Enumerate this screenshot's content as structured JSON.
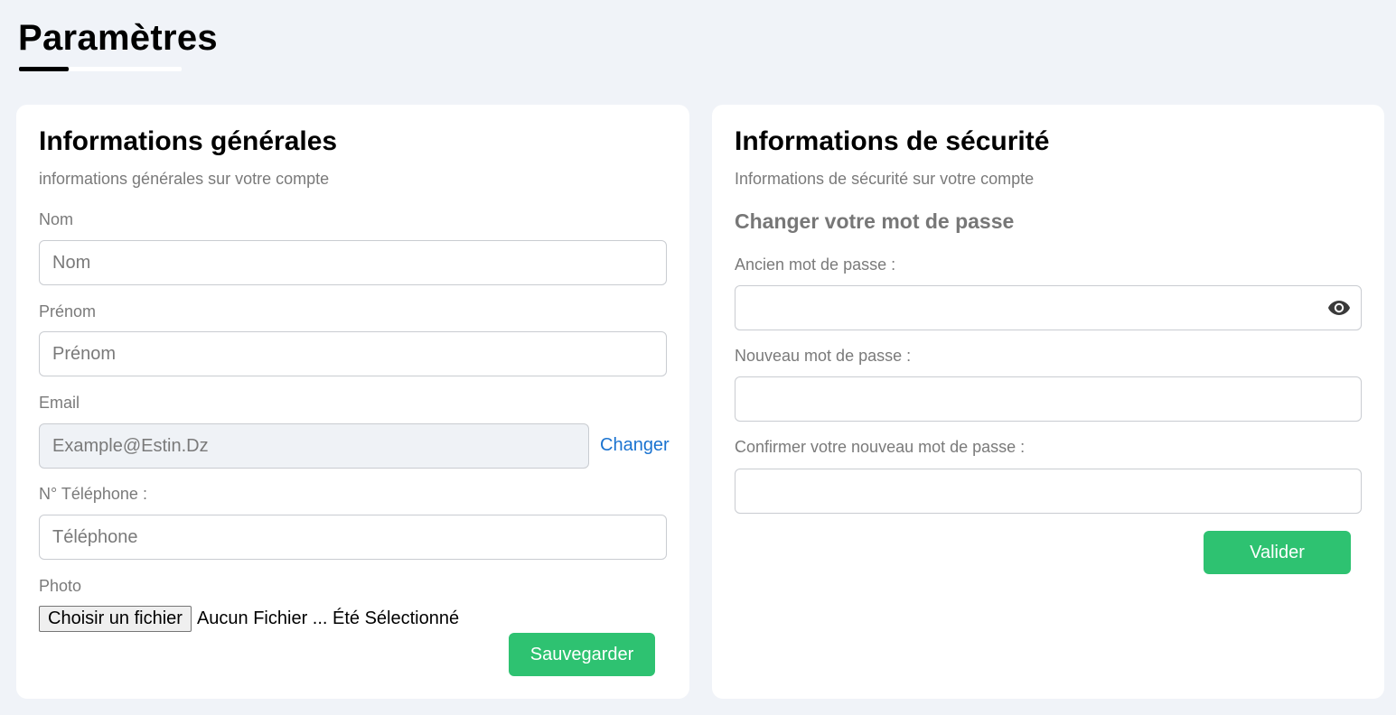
{
  "page": {
    "title": "Paramètres"
  },
  "general": {
    "title": "Informations générales",
    "subtitle": "informations générales sur votre compte",
    "nom_label": "Nom",
    "nom_placeholder": "Nom",
    "prenom_label": "Prénom",
    "prenom_placeholder": "Prénom",
    "email_label": "Email",
    "email_placeholder": "Example@Estin.Dz",
    "change_link": "Changer",
    "phone_label": "N° Téléphone :",
    "phone_placeholder": "Téléphone",
    "photo_label": "Photo",
    "file_button": "Choisir un fichier",
    "file_status": "Aucun Fichier ... Été Sélectionné",
    "save_button": "Sauvegarder"
  },
  "security": {
    "title": "Informations de sécurité",
    "subtitle": "Informations de sécurité sur votre compte",
    "section_heading": "Changer votre mot de passe",
    "old_pw_label": "Ancien mot de passe :",
    "new_pw_label": "Nouveau mot de passe :",
    "confirm_pw_label": "Confirmer votre nouveau mot de passe :",
    "validate_button": "Valider",
    "eye_icon": "eye-icon"
  },
  "colors": {
    "background": "#f0f3f8",
    "card": "#ffffff",
    "accent_green": "#2ec271",
    "link_blue": "#1a73d0",
    "muted_text": "#7a7a7a"
  }
}
